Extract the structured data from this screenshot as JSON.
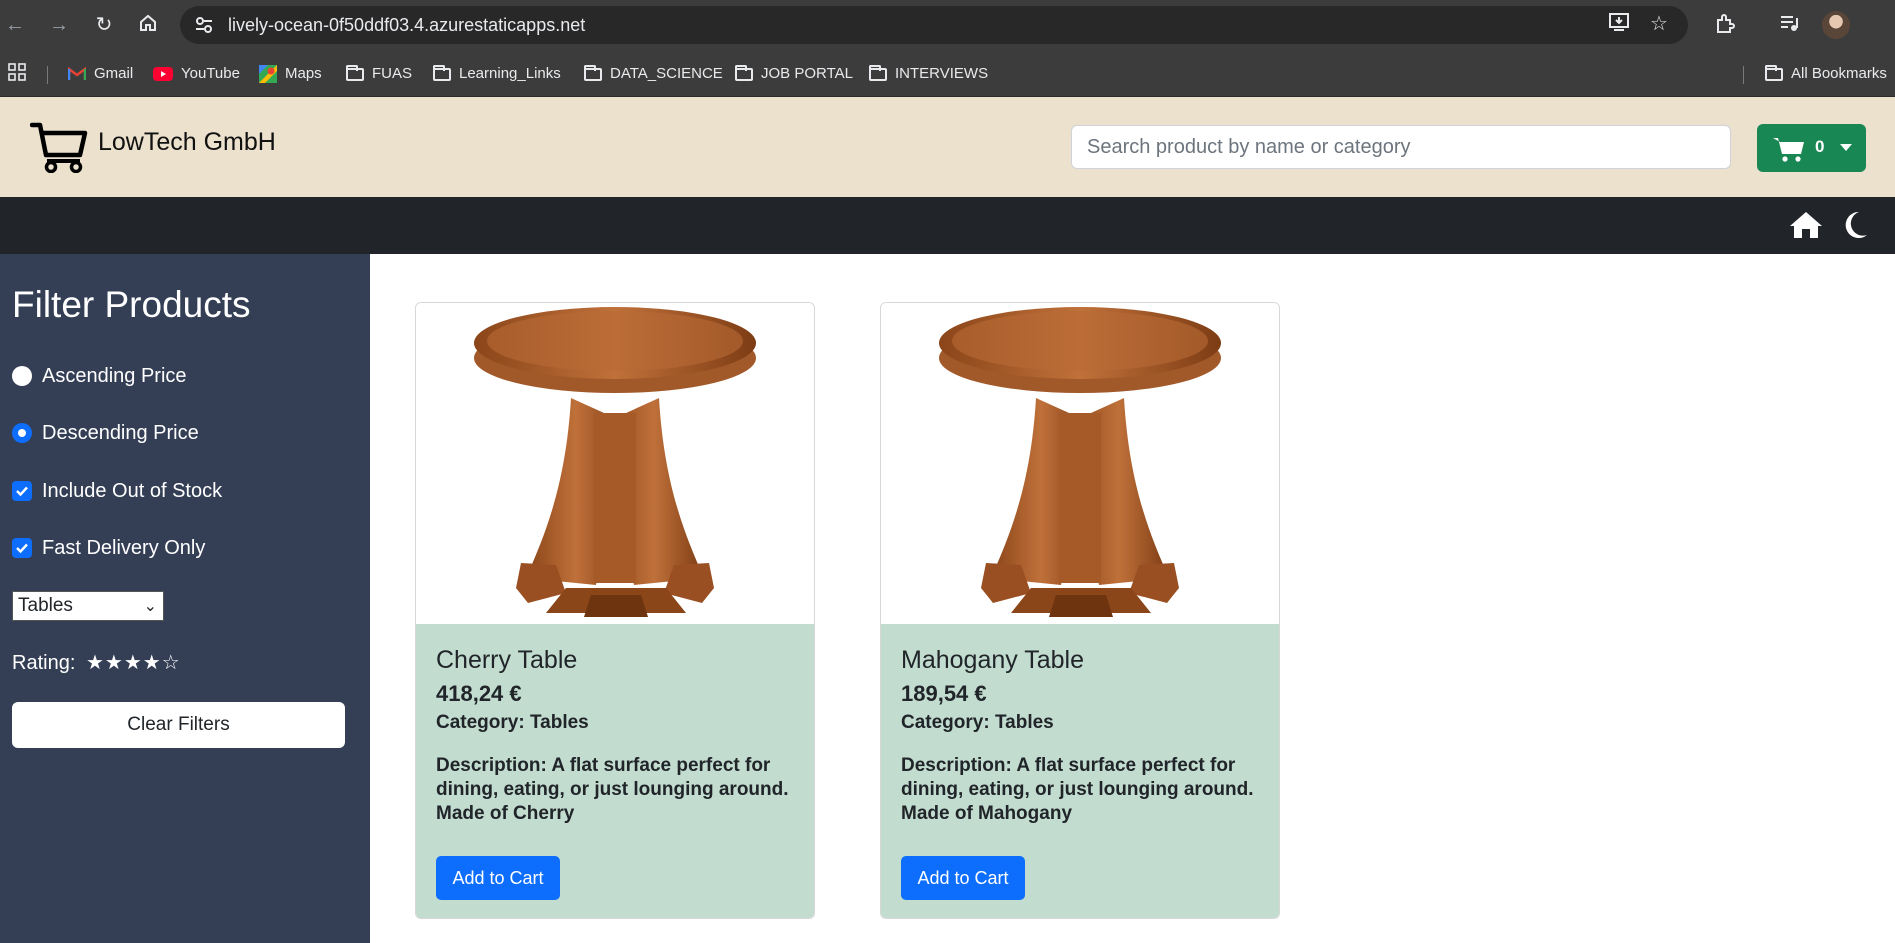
{
  "browser": {
    "url": "lively-ocean-0f50ddf03.4.azurestaticapps.net",
    "bookmarks": [
      "Gmail",
      "YouTube",
      "Maps",
      "FUAS",
      "Learning_Links",
      "DATA_SCIENCE",
      "JOB PORTAL",
      "INTERVIEWS"
    ],
    "all_bookmarks": "All Bookmarks"
  },
  "header": {
    "brand": "LowTech GmbH",
    "search_placeholder": "Search product by name or category",
    "cart_count": "0",
    "accent_color": "#198754"
  },
  "sidebar": {
    "title": "Filter Products",
    "ascending": "Ascending Price",
    "descending": "Descending Price",
    "out_of_stock": "Include Out of Stock",
    "fast_delivery": "Fast Delivery Only",
    "category_selected": "Tables",
    "rating_label": "Rating:",
    "rating_value": 4,
    "rating_max": 5,
    "stars_text": "★★★★☆",
    "clear_button": "Clear Filters",
    "background": "#343f56"
  },
  "products": [
    {
      "name": "Cherry Table",
      "price": "418,24 €",
      "category": "Category: Tables",
      "description": "Description: A flat surface perfect for dining, eating, or just lounging around. Made of Cherry",
      "button": "Add to Cart"
    },
    {
      "name": "Mahogany Table",
      "price": "189,54 €",
      "category": "Category: Tables",
      "description": "Description: A flat surface perfect for dining, eating, or just lounging around. Made of Mahogany",
      "button": "Add to Cart"
    }
  ]
}
